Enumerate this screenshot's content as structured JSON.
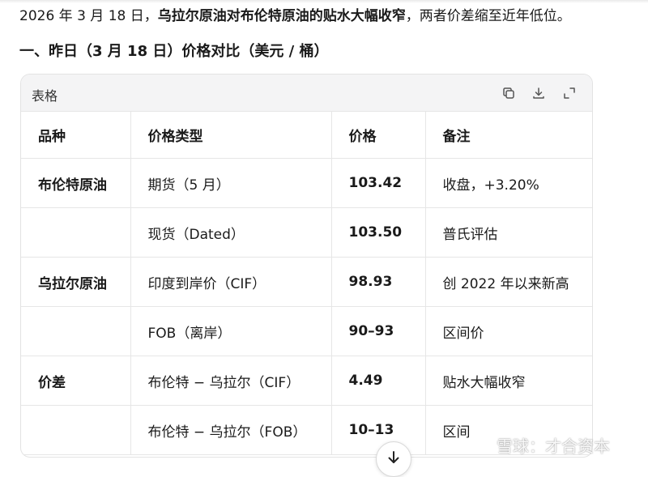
{
  "intro": {
    "prefix": "2026 年 3 月 18 日，",
    "bold": "乌拉尔原油对布伦特原油的贴水大幅收窄",
    "suffix": "，两者价差缩至近年低位。"
  },
  "section": {
    "heading": "一、昨日（3 月 18 日）价格对比（美元 / 桶）"
  },
  "table": {
    "label": "表格",
    "tool_icons": [
      "copy-icon",
      "download-icon",
      "expand-icon"
    ],
    "headers": [
      "品种",
      "价格类型",
      "价格",
      "备注"
    ],
    "rows": [
      [
        "布伦特原油",
        "期货（5 月）",
        "103.42",
        "收盘，+3.20%"
      ],
      [
        "",
        "现货（Dated）",
        "103.50",
        "普氏评估"
      ],
      [
        "乌拉尔原油",
        "印度到岸价（CIF）",
        "98.93",
        "创 2022 年以来新高"
      ],
      [
        "",
        "FOB（离岸）",
        "90–93",
        "区间价"
      ],
      [
        "价差",
        "布伦特 − 乌拉尔（CIF）",
        "4.49",
        "贴水大幅收窄"
      ],
      [
        "",
        "布伦特 − 乌拉尔（FOB）",
        "10–13",
        "区间"
      ]
    ]
  },
  "scroll_button": {
    "icon": "arrow-down-icon"
  },
  "watermark": {
    "text": "雪球：才合资本",
    "icon": "snowball-logo-icon"
  }
}
